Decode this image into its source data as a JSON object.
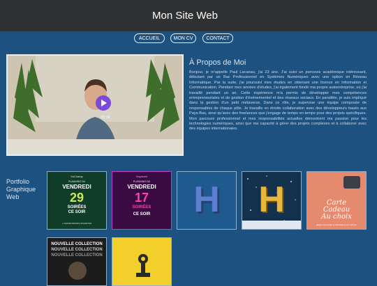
{
  "header": {
    "title": "Mon Site Web"
  },
  "nav": {
    "items": [
      {
        "label": "ACCUEIL"
      },
      {
        "label": "MON CV"
      },
      {
        "label": "CONTACT"
      }
    ]
  },
  "video": {
    "time": "01:24"
  },
  "about": {
    "title": "À Propos de Moi",
    "text": "Bonjour, je m'appelle Paul Lacanau, j'ai 23 ans. J'ai suivi un parcours académique intéressant, débutant par un Bac Professionnel en Systèmes Numériques avec une option en Réseau Informatique. Par la suite, j'ai poursuivi mes études en obtenant une licence en Information et Communication. Pendant mes années d'études, j'ai également fondé ma propre autoentreprise, où j'ai travaillé pendant un an. Cette expérience m'a permis de développer mes compétences entrepreneuriales et de gestion d'événementiel et des réseaux sociaux. En parallèle, je suis impliqué dans la gestion d'un petit métaverse. Dans ce rôle, je supervise une équipe composée de responsables de chaque pôle. Je travaille en étroite collaboration avec des développeurs basés aux Pays-Bas, ainsi qu'avec des freelances que j'engage de temps en temps pour des projets spécifiques. Mon parcours professionnel et mes responsabilités actuelles démontrent ma passion pour les technologies numériques, ainsi que ma capacité à gérer des projets complexes et à collaborer avec des équipes internationales."
  },
  "portfolio": {
    "title": "Portfolio Graphique Web",
    "thumbs": {
      "t1": {
        "brand": "VoChamp",
        "sub": "PLANNING DU",
        "day": "VENDREDI",
        "num": "29",
        "line1": "SOIRÉES",
        "line2": "CE SOIR",
        "foot": "+ DES BOISSONS OFFERTES"
      },
      "t2": {
        "brand": "Hayaweb",
        "sub": "PLANNING DU",
        "day": "VENDREDI",
        "num": "17",
        "line1": "SOIRÉES",
        "line2": "CE SOIR"
      },
      "t3": {
        "letter": "H"
      },
      "t4": {
        "letter": "H"
      },
      "t5": {
        "line1": "Carte",
        "line2": "Cadeau",
        "line3": "Au choix",
        "foot": "gagne une soirée et sélectionne ton cadeau"
      },
      "t6": {
        "line1": "NOUVELLE COLLECTION",
        "line2": "NOUVELLE COLLECTION",
        "line3": "NOUVELLE COLLECTION"
      }
    }
  },
  "colors": {
    "background": "#1d5180",
    "topbar": "#2f3133",
    "accent": "#7b4bd6"
  }
}
